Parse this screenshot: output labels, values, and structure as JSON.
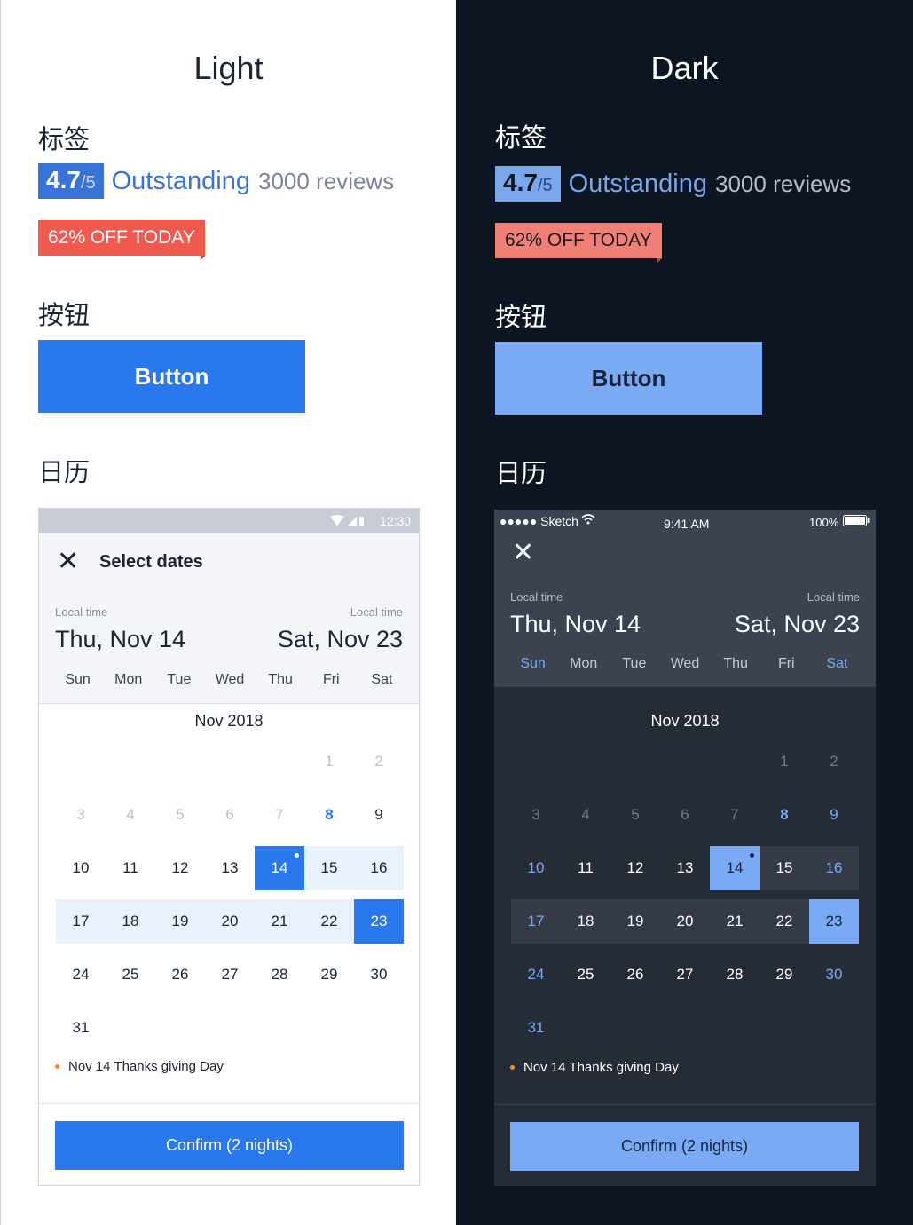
{
  "light": {
    "title": "Light",
    "tag_section": "标签",
    "button_section": "按钮",
    "calendar_section": "日历",
    "rating_score": "4.7",
    "rating_scale": "/5",
    "rating_word": "Outstanding",
    "reviews": "3000 reviews",
    "offer": "62% OFF TODAY",
    "button_label": "Button",
    "status_time": "12:30",
    "sheet_title": "Select dates",
    "start_label": "Local time",
    "start_date": "Thu, Nov 14",
    "end_label": "Local time",
    "end_date": "Sat, Nov 23",
    "month": "Nov 2018",
    "holiday": "Nov 14 Thanks giving Day",
    "confirm": "Confirm (2 nights)"
  },
  "dark": {
    "title": "Dark",
    "tag_section": "标签",
    "button_section": "按钮",
    "calendar_section": "日历",
    "rating_score": "4.7",
    "rating_scale": "/5",
    "rating_word": "Outstanding",
    "reviews": "3000 reviews",
    "offer": "62% OFF TODAY",
    "button_label": "Button",
    "status_carrier": "●●●●● Sketch",
    "status_time": "9:41 AM",
    "status_battery": "100%",
    "start_label": "Local time",
    "start_date": "Thu, Nov 14",
    "end_label": "Local time",
    "end_date": "Sat, Nov 23",
    "month": "Nov 2018",
    "holiday": "Nov 14 Thanks giving Day",
    "confirm": "Confirm (2 nights)"
  },
  "weekdays": [
    "Sun",
    "Mon",
    "Tue",
    "Wed",
    "Thu",
    "Fri",
    "Sat"
  ],
  "weeks": [
    [
      "",
      "",
      "",
      "",
      "",
      "1",
      "2"
    ],
    [
      "3",
      "4",
      "5",
      "6",
      "7",
      "8",
      "9"
    ],
    [
      "10",
      "11",
      "12",
      "13",
      "14",
      "15",
      "16"
    ],
    [
      "17",
      "18",
      "19",
      "20",
      "21",
      "22",
      "23"
    ],
    [
      "24",
      "25",
      "26",
      "27",
      "28",
      "29",
      "30"
    ],
    [
      "31",
      "",
      "",
      "",
      "",
      "",
      ""
    ]
  ],
  "colors": {
    "light_accent": "#2a78ee",
    "dark_accent": "#7aaaf4",
    "dark_bg": "#0d1522",
    "offer_light": "#f05a4e",
    "offer_dark": "#f08076",
    "holiday_dot": "#f58a2a"
  }
}
